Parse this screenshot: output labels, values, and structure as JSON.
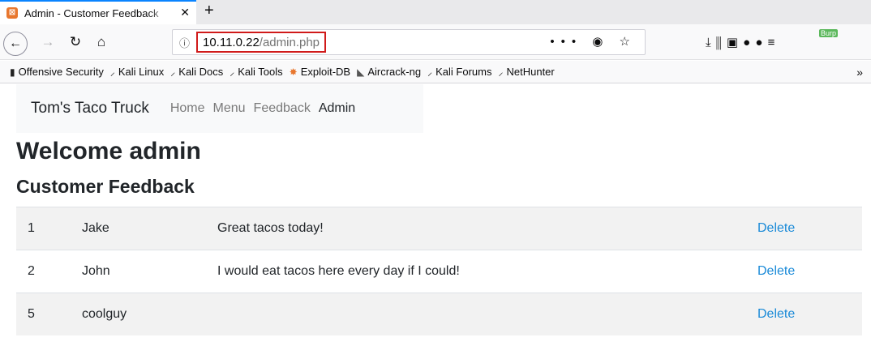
{
  "browser": {
    "tab_title": "Admin - Customer Feedback",
    "url_host": "10.11.0.22",
    "url_path": "/admin.php",
    "url_actions": "••• ◉ ☆",
    "toolbar_right": "⤓  ⫼  ▣  ●  ●  ≡",
    "burp_label": "Burp",
    "bookmarks": [
      {
        "label": "Offensive Security",
        "icon": "offsec-icon"
      },
      {
        "label": "Kali Linux",
        "icon": "kali-dragon-icon"
      },
      {
        "label": "Kali Docs",
        "icon": "kali-dragon-icon"
      },
      {
        "label": "Kali Tools",
        "icon": "kali-dragon-icon"
      },
      {
        "label": "Exploit-DB",
        "icon": "exploitdb-icon"
      },
      {
        "label": "Aircrack-ng",
        "icon": "aircrack-icon"
      },
      {
        "label": "Kali Forums",
        "icon": "kali-dragon-icon"
      },
      {
        "label": "NetHunter",
        "icon": "kali-dragon-icon"
      }
    ]
  },
  "site": {
    "brand": "Tom's Taco Truck",
    "nav": [
      "Home",
      "Menu",
      "Feedback",
      "Admin"
    ],
    "active_nav": "Admin"
  },
  "page": {
    "welcome": "Welcome admin",
    "section_title": "Customer Feedback",
    "rows": [
      {
        "id": "1",
        "name": "Jake",
        "message": "Great tacos today!",
        "action": "Delete"
      },
      {
        "id": "2",
        "name": "John",
        "message": "I would eat tacos here every day if I could!",
        "action": "Delete"
      },
      {
        "id": "5",
        "name": "coolguy",
        "message": "",
        "action": "Delete"
      }
    ]
  },
  "colors": {
    "link": "#1a8ad8",
    "url_highlight": "#d01a1a",
    "tab_accent": "#0a84ff"
  }
}
